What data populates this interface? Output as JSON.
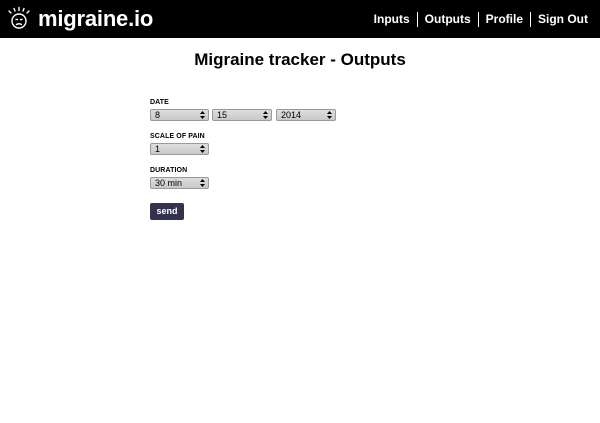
{
  "brand": {
    "name": "migraine.io",
    "logo_icon": "face-icon"
  },
  "nav": {
    "items": [
      {
        "label": "Inputs"
      },
      {
        "label": "Outputs"
      },
      {
        "label": "Profile"
      },
      {
        "label": "Sign Out"
      }
    ]
  },
  "page": {
    "title": "Migraine tracker - Outputs"
  },
  "form": {
    "date": {
      "label": "DATE",
      "month": "8",
      "day": "15",
      "year": "2014"
    },
    "pain": {
      "label": "SCALE OF PAIN",
      "value": "1"
    },
    "duration": {
      "label": "DURATION",
      "value": "30 min"
    },
    "submit_label": "send"
  },
  "colors": {
    "topbar": "#000000",
    "button": "#333350",
    "select": "#d4d4d4"
  }
}
